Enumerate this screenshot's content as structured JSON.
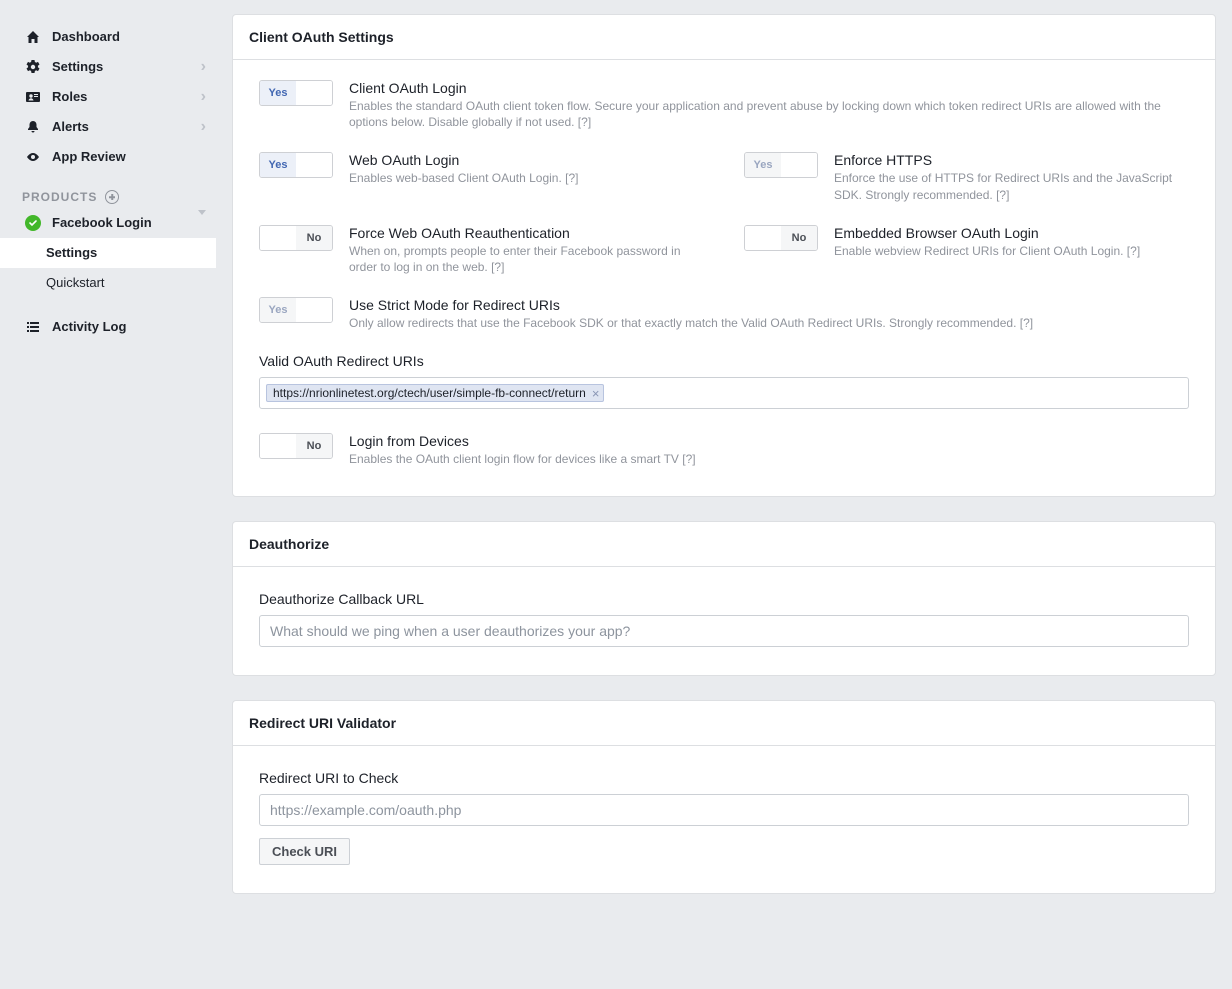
{
  "sidebar": {
    "items": [
      {
        "label": "Dashboard"
      },
      {
        "label": "Settings"
      },
      {
        "label": "Roles"
      },
      {
        "label": "Alerts"
      },
      {
        "label": "App Review"
      }
    ],
    "products_header": "PRODUCTS",
    "product": {
      "label": "Facebook Login",
      "sub": [
        {
          "label": "Settings"
        },
        {
          "label": "Quickstart"
        }
      ]
    },
    "activity": {
      "label": "Activity Log"
    }
  },
  "oauth": {
    "panel_title": "Client OAuth Settings",
    "client_login": {
      "toggle": "Yes",
      "title": "Client OAuth Login",
      "desc": "Enables the standard OAuth client token flow. Secure your application and prevent abuse by locking down which token redirect URIs are allowed with the options below. Disable globally if not used.  [?]"
    },
    "web_login": {
      "toggle": "Yes",
      "title": "Web OAuth Login",
      "desc": "Enables web-based Client OAuth Login.  [?]"
    },
    "enforce_https": {
      "toggle": "Yes",
      "title": "Enforce HTTPS",
      "desc": "Enforce the use of HTTPS for Redirect URIs and the JavaScript SDK. Strongly recommended.  [?]"
    },
    "force_reauth": {
      "toggle": "No",
      "title": "Force Web OAuth Reauthentication",
      "desc": "When on, prompts people to enter their Facebook password in order to log in on the web.  [?]"
    },
    "embedded": {
      "toggle": "No",
      "title": "Embedded Browser OAuth Login",
      "desc": "Enable webview Redirect URIs for Client OAuth Login.  [?]"
    },
    "strict_mode": {
      "toggle": "Yes",
      "title": "Use Strict Mode for Redirect URIs",
      "desc": "Only allow redirects that use the Facebook SDK or that exactly match the Valid OAuth Redirect URIs. Strongly recommended.  [?]"
    },
    "redirect_uris": {
      "label": "Valid OAuth Redirect URIs",
      "token": "https://nrionlinetest.org/ctech/user/simple-fb-connect/return"
    },
    "login_devices": {
      "toggle": "No",
      "title": "Login from Devices",
      "desc": "Enables the OAuth client login flow for devices like a smart TV [?]"
    }
  },
  "deauth": {
    "panel_title": "Deauthorize",
    "field_label": "Deauthorize Callback URL",
    "placeholder": "What should we ping when a user deauthorizes your app?"
  },
  "validator": {
    "panel_title": "Redirect URI Validator",
    "field_label": "Redirect URI to Check",
    "placeholder": "https://example.com/oauth.php",
    "button": "Check URI"
  }
}
